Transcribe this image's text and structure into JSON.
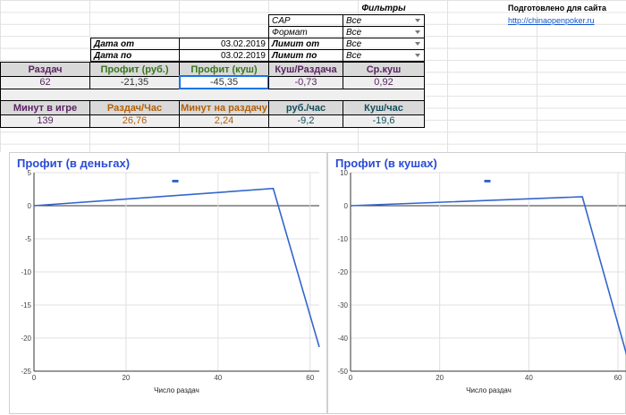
{
  "header": {
    "filters_title": "Фильтры",
    "credit": "Подготовлено для сайта",
    "link": "http://chinaopenpoker.ru"
  },
  "filters": [
    {
      "label": "CAP",
      "value": "Все"
    },
    {
      "label": "Формат",
      "value": "Все"
    },
    {
      "label": "Лимит от",
      "value": "Все"
    },
    {
      "label": "Лимит по",
      "value": "Все"
    }
  ],
  "dates": {
    "from_label": "Дата от",
    "from_value": "03.02.2019",
    "to_label": "Дата по",
    "to_value": "03.02.2019"
  },
  "stats1": {
    "headers": [
      "Раздач",
      "Профит (руб.)",
      "Профит (куш)",
      "Куш/Раздача",
      "Ср.куш"
    ],
    "values": [
      "62",
      "-21,35",
      "-45,35",
      "-0,73",
      "0,92"
    ]
  },
  "stats2": {
    "headers": [
      "Минут в игре",
      "Раздач/Час",
      "Минут на раздачу",
      "руб./час",
      "Куш/час"
    ],
    "values": [
      "139",
      "26,76",
      "2,24",
      "-9,2",
      "-19,6"
    ]
  },
  "colors": {
    "h_purple": "#5b2463",
    "h_green": "#38761d",
    "h_orange": "#b45f06",
    "h_teal": "#134f5c",
    "v_default": "#333333",
    "line": "#3366cc"
  },
  "chart_data": [
    {
      "type": "line",
      "title": "Профит (в деньгах)",
      "xlabel": "Число раздач",
      "ylabel": "",
      "x": [
        0,
        52,
        62
      ],
      "series": [
        {
          "values": [
            0,
            2.6,
            -21.35
          ]
        }
      ],
      "xlim": [
        0,
        62
      ],
      "ylim": [
        -25,
        5
      ],
      "xticks": [
        0,
        20,
        40,
        60
      ],
      "yticks": [
        5,
        0,
        -5,
        -10,
        -15,
        -20,
        -25
      ],
      "grid": true
    },
    {
      "type": "line",
      "title": "Профит (в кушах)",
      "xlabel": "Число раздач",
      "ylabel": "",
      "x": [
        0,
        52,
        62
      ],
      "series": [
        {
          "values": [
            0,
            2.7,
            -45.35
          ]
        }
      ],
      "xlim": [
        0,
        62
      ],
      "ylim": [
        -50,
        10
      ],
      "xticks": [
        0,
        20,
        40,
        60
      ],
      "yticks": [
        10,
        0,
        -10,
        -20,
        -30,
        -40,
        -50
      ],
      "grid": true
    }
  ]
}
